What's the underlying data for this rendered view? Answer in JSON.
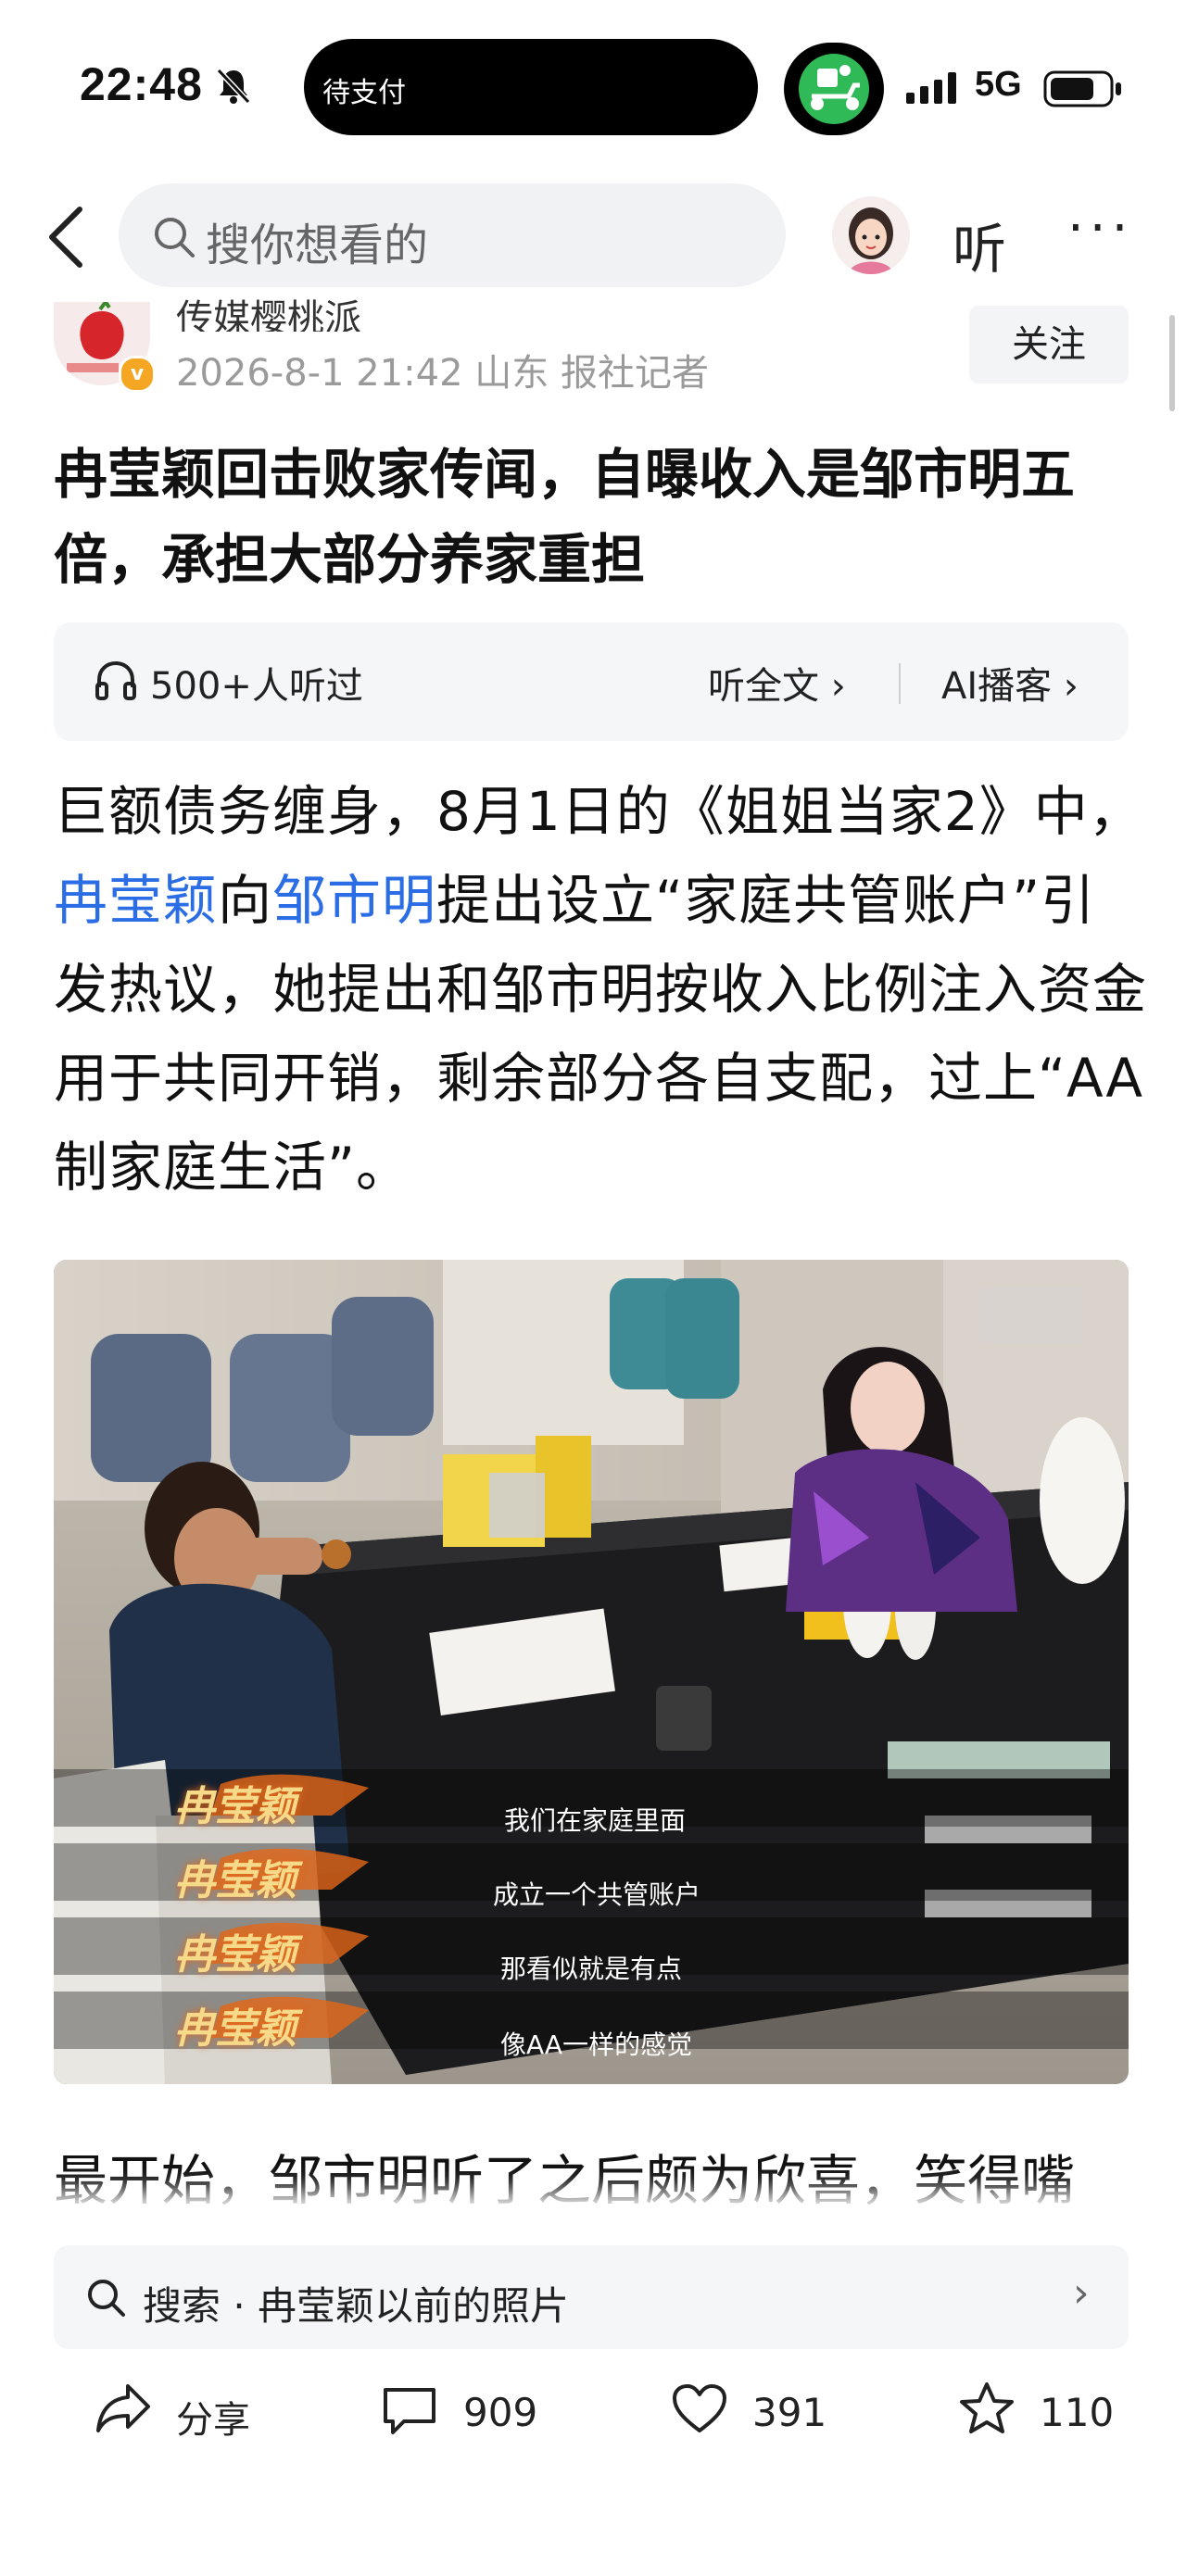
{
  "status_bar": {
    "time": "22:48",
    "island_text": "待支付",
    "network": "5G"
  },
  "nav": {
    "search_placeholder": "搜你想看的",
    "listen_label": "听",
    "more_label": "···"
  },
  "author": {
    "name": "传媒樱桃派",
    "meta": "2026-8-1 21:42 山东 报社记者",
    "follow_label": "关注",
    "verified_badge": "v"
  },
  "article": {
    "title": "冉莹颖回击败家传闻，自曝收入是邹市明五倍，承担大部分养家重担",
    "audio": {
      "listen_count": "500+人听过",
      "full_text_label": "听全文",
      "ai_podcast_label": "AI播客"
    },
    "paragraph1": {
      "part1": "巨额债务缠身，8月1日的《姐姐当家2》中，",
      "link1": "冉莹颖",
      "part2": "向",
      "link2": "邹市明",
      "part3": "提出设立“家庭共管账户”引发热议，她提出和邹市明按收入比例注入资金用于共同开销，剩余部分各自支配，过上“AA制家庭生活”。"
    },
    "image_captions": [
      "我们在家庭里面",
      "成立一个共管账户",
      "那看似就是有点",
      "像AA一样的感觉"
    ],
    "subtitle_name": "冉莹颖",
    "paragraph2": "最开始，邹市明听了之后颇为欣喜，笑得嘴"
  },
  "bottom": {
    "search_text": "搜索 · 冉莹颖以前的照片",
    "share_label": "分享",
    "comment_count": "909",
    "like_count": "391",
    "star_count": "110"
  },
  "colors": {
    "link": "#2a6de5",
    "badge": "#f5a623",
    "gray_bg": "#f5f6f8"
  }
}
